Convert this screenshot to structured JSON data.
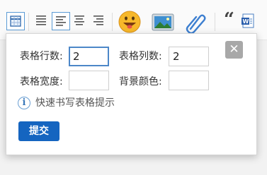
{
  "toolbar": {
    "items": [
      {
        "name": "table-icon",
        "active": true
      },
      {
        "name": "align-justify-icon",
        "active": false
      },
      {
        "name": "align-left-icon",
        "active": true
      },
      {
        "name": "align-center-icon",
        "active": false
      },
      {
        "name": "align-right-icon",
        "active": false
      },
      {
        "name": "emoji-icon",
        "active": false
      },
      {
        "name": "image-icon",
        "active": false
      },
      {
        "name": "attachment-icon",
        "active": false
      },
      {
        "name": "quote-icon",
        "active": false
      },
      {
        "name": "word-icon",
        "active": false
      }
    ],
    "quote_glyph": "“"
  },
  "dialog": {
    "rows_label": "表格行数:",
    "rows_value": "2",
    "cols_label": "表格列数:",
    "cols_value": "2",
    "width_label": "表格宽度:",
    "width_value": "",
    "bg_label": "背景颜色:",
    "bg_value": "",
    "close_label": "✕",
    "hint_icon": "i",
    "hint_text": "快速书写表格提示",
    "submit_label": "提交"
  },
  "colors": {
    "accent": "#1565c0",
    "focus_border": "#4c87c8",
    "close_bg": "#a8a8a8"
  }
}
